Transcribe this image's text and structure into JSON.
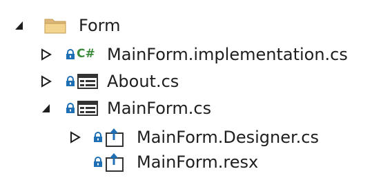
{
  "tree": {
    "nodes": [
      {
        "label": "Form",
        "state": "expanded",
        "icon": "folder-icon"
      },
      {
        "label": "MainForm.implementation.cs",
        "state": "collapsed",
        "icon": "csharp-file-icon",
        "icon_text": "C#"
      },
      {
        "label": "About.cs",
        "state": "collapsed",
        "icon": "form-file-icon"
      },
      {
        "label": "MainForm.cs",
        "state": "expanded",
        "icon": "form-file-icon"
      },
      {
        "label": "MainForm.Designer.cs",
        "state": "collapsed",
        "icon": "designer-file-icon"
      },
      {
        "label": "MainForm.resx",
        "state": "leaf",
        "icon": "resource-file-icon"
      }
    ]
  },
  "colors": {
    "text": "#1e1e1e",
    "folder": "#dcb67a",
    "lock": "#1f6fb5",
    "csharp": "#3a8a3a",
    "arrow": "#1e1e1e"
  }
}
